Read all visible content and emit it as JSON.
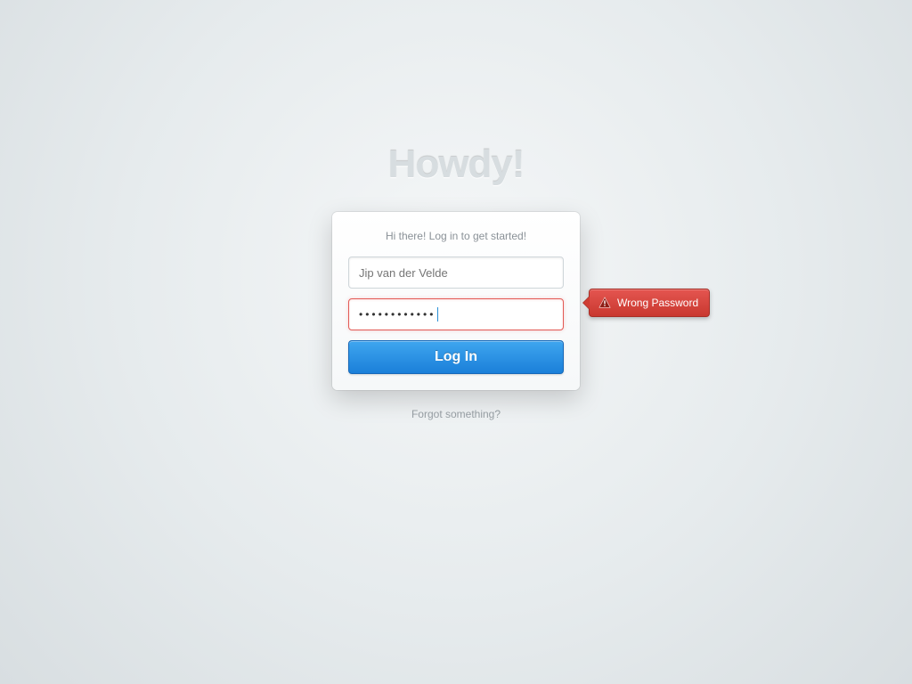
{
  "heading": "Howdy!",
  "card": {
    "greeting": "Hi there! Log in to get started!",
    "username_placeholder": "Jip van der Velde",
    "username_value": "",
    "password_mask": "••••••••••••",
    "login_label": "Log In"
  },
  "error": {
    "message": "Wrong Password",
    "icon": "warning-icon"
  },
  "forgot_label": "Forgot something?",
  "colors": {
    "primary": "#1b7fd9",
    "error": "#d2433a"
  }
}
